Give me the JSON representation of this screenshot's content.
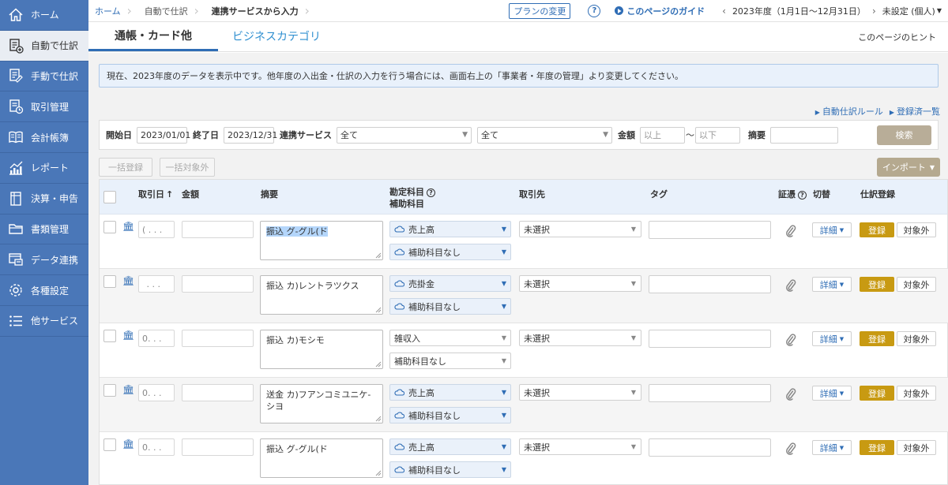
{
  "sidebar": {
    "items": [
      {
        "label": "ホーム",
        "icon": "home-icon"
      },
      {
        "label": "自動で仕訳",
        "icon": "auto-entry-icon",
        "active": true
      },
      {
        "label": "手動で仕訳",
        "icon": "manual-entry-icon"
      },
      {
        "label": "取引管理",
        "icon": "transaction-icon"
      },
      {
        "label": "会計帳簿",
        "icon": "book-icon"
      },
      {
        "label": "レポート",
        "icon": "report-icon"
      },
      {
        "label": "決算・申告",
        "icon": "closing-icon"
      },
      {
        "label": "書類管理",
        "icon": "folder-icon"
      },
      {
        "label": "データ連携",
        "icon": "data-link-icon"
      },
      {
        "label": "各種設定",
        "icon": "gear-icon"
      },
      {
        "label": "他サービス",
        "icon": "list-icon"
      }
    ]
  },
  "breadcrumb": {
    "home": "ホーム",
    "auto": "自動で仕訳",
    "current": "連携サービスから入力"
  },
  "topbar": {
    "plan_change": "プランの変更",
    "help": "?",
    "guide": "このページのガイド",
    "year_prev": "‹",
    "year": "2023年度（1月1日〜12月31日）",
    "year_next": "›",
    "entity": "未設定 (個人)"
  },
  "tabs": {
    "active": "通帳・カード他",
    "other": "ビジネスカテゴリ",
    "hint": "このページのヒント"
  },
  "notice": "現在、2023年度のデータを表示中です。他年度の入出金・仕訳の入力を行う場合には、画面右上の「事業者・年度の管理」より変更してください。",
  "links": {
    "auto_rule": "自動仕訳ルール",
    "registered": "登録済一覧"
  },
  "filter": {
    "start_label": "開始日",
    "start_value": "2023/01/01",
    "end_label": "終了日",
    "end_value": "2023/12/31",
    "service_label": "連携サービス",
    "service_value": "全て",
    "second_value": "全て",
    "amount_label": "金額",
    "amount_min_ph": "以上",
    "amount_sep": "〜",
    "amount_max_ph": "以下",
    "memo_label": "摘要",
    "search": "検索"
  },
  "actions": {
    "bulk_register": "一括登録",
    "bulk_exclude": "一括対象外",
    "import": "インポート"
  },
  "table": {
    "headers": {
      "date": "取引日",
      "amount": "金額",
      "memo": "摘要",
      "account": "勘定科目",
      "subaccount": "補助科目",
      "partner": "取引先",
      "tag": "タグ",
      "evidence": "証憑",
      "switch": "切替",
      "register": "仕訳登録"
    },
    "rows": [
      {
        "date": "( . . .",
        "memo": "振込 グ-グル(ド",
        "account": "売上高",
        "sub": "補助科目なし",
        "partner": "未選択",
        "cloud": true
      },
      {
        "date": " . . .",
        "memo": "振込 カ)レントラツクス",
        "account": "売掛金",
        "sub": "補助科目なし",
        "partner": "未選択",
        "cloud": true
      },
      {
        "date": "0. . .",
        "memo": "振込 カ)モシモ",
        "account": "雑収入",
        "sub": "補助科目なし",
        "partner": "未選択",
        "cloud": false
      },
      {
        "date": "0. . .",
        "memo": "送金 カ)フアンコミユニケ-シヨ",
        "account": "売上高",
        "sub": "補助科目なし",
        "partner": "未選択",
        "cloud": true
      },
      {
        "date": "0. . .",
        "memo": "振込 グ-グル(ド",
        "account": "売上高",
        "sub": "補助科目なし",
        "partner": "未選択",
        "cloud": true
      }
    ],
    "detail": "詳細",
    "register": "登録",
    "exclude": "対象外"
  }
}
